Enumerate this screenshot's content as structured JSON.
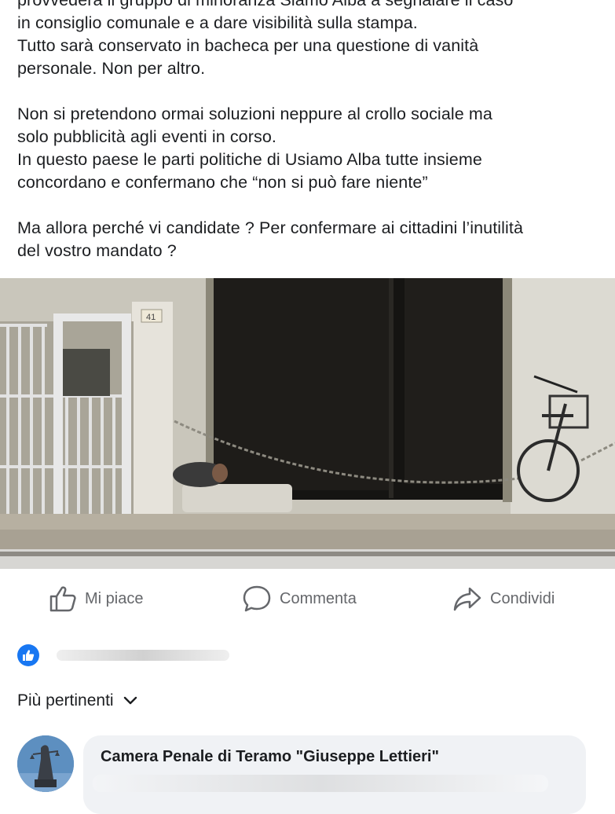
{
  "post": {
    "lines_a": [
      "provvederà il gruppo di minoranza Siamo Alba a segnalare il caso",
      "in consiglio comunale e a dare visibilità sulla stampa.",
      "Tutto sarà conservato in bacheca per una questione di vanità",
      "personale. Non per altro."
    ],
    "lines_b": [
      "Non si pretendono ormai soluzioni neppure al crollo sociale ma",
      "solo pubblicità agli eventi in corso.",
      "In questo paese le parti politiche di Usiamo Alba tutte insieme",
      "concordano e confermano che “non si può fare niente”"
    ],
    "lines_c": [
      "Ma allora perché vi candidate ? Per confermare ai cittadini l’inutilità",
      "del vostro mandato ?"
    ],
    "photo_sign": "41"
  },
  "actions": {
    "like": "Mi piace",
    "comment": "Commenta",
    "share": "Condividi"
  },
  "sort": {
    "label": "Più pertinenti"
  },
  "comment": {
    "author": "Camera Penale di Teramo \"Giuseppe Lettieri\""
  },
  "colors": {
    "like_blue": "#1877f2",
    "muted": "#65676b",
    "bubble": "#f0f2f5"
  },
  "icons": {
    "like": "thumbs-up-icon",
    "comment": "speech-bubble-icon",
    "share": "share-arrow-icon",
    "reaction": "like-reaction-icon",
    "sort": "chevron-down-icon"
  }
}
